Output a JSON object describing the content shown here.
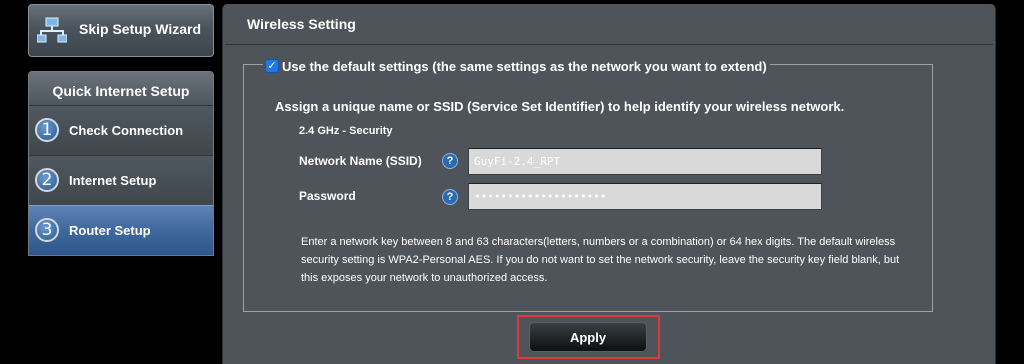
{
  "sidebar": {
    "skip_label": "Skip Setup Wizard",
    "qis_title": "Quick Internet Setup",
    "steps": [
      {
        "num": "1",
        "label": "Check Connection"
      },
      {
        "num": "2",
        "label": "Internet Setup"
      },
      {
        "num": "3",
        "label": "Router Setup"
      }
    ],
    "active_step": 3
  },
  "main": {
    "title": "Wireless Setting",
    "use_default_checked": true,
    "use_default_label": "Use the default settings (the same settings as the network you want to extend)",
    "assign_text": "Assign a unique name or SSID (Service Set Identifier) to help identify your wireless network.",
    "band_label": "2.4 GHz - Security",
    "ssid_label": "Network Name (SSID)",
    "ssid_value": "GuyFi-2.4_RPT",
    "password_label": "Password",
    "password_value": "••••••••••••••••••••",
    "help_symbol": "?",
    "note": "Enter a network key between 8 and 63 characters(letters, numbers or a combination) or 64 hex digits. The default wireless security setting is WPA2-Personal AES. If you do not want to set the network security, leave the security key field blank, but this exposes your network to unauthorized access.",
    "apply_label": "Apply"
  },
  "colors": {
    "active_step": "#3f689d",
    "panel_bg": "#4e5459",
    "highlight_box": "#e0393a",
    "checkbox": "#1f78e6"
  }
}
